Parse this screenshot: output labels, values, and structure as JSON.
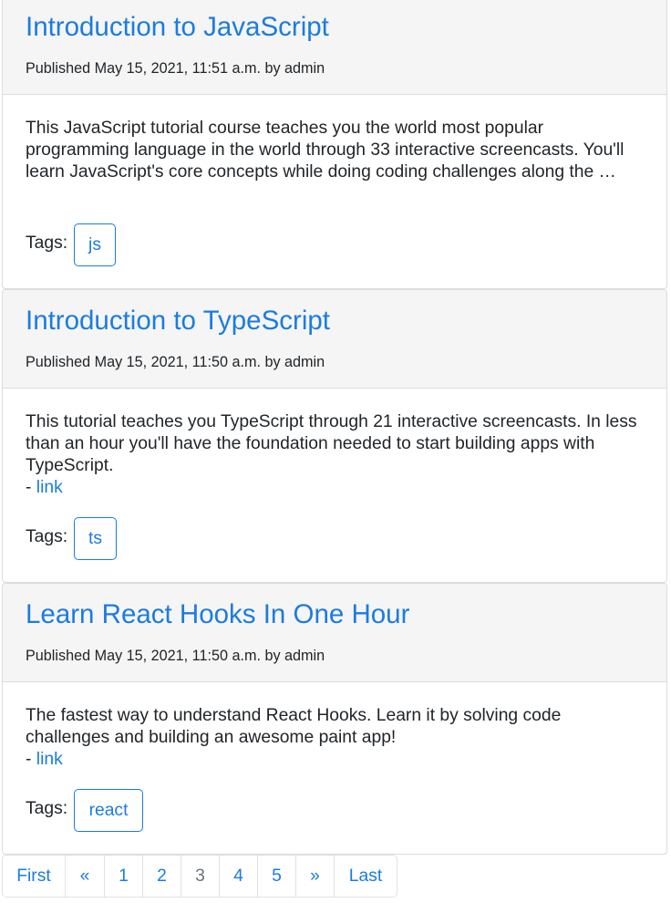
{
  "posts": [
    {
      "title": "Introduction to JavaScript",
      "meta": "Published May 15, 2021, 11:51 a.m. by admin",
      "body": "This JavaScript tutorial course teaches you the world most popular programming language in the world through 33 interactive screencasts. You'll learn JavaScript's core concepts while doing coding challenges along the …",
      "tags_label": "Tags:",
      "tags": [
        "js"
      ]
    },
    {
      "title": "Introduction to TypeScript",
      "meta": "Published May 15, 2021, 11:50 a.m. by admin",
      "body": "This tutorial teaches you TypeScript through 21 interactive screencasts. In less than an hour you'll have the foundation needed to start building apps with TypeScript.",
      "link_prefix": "- ",
      "link_text": "link",
      "tags_label": "Tags:",
      "tags": [
        "ts"
      ]
    },
    {
      "title": "Learn React Hooks In One Hour",
      "meta": "Published May 15, 2021, 11:50 a.m. by admin",
      "body": "The fastest way to understand React Hooks. Learn it by solving code challenges and building an awesome paint app!",
      "link_prefix": "- ",
      "link_text": "link",
      "tags_label": "Tags:",
      "tags": [
        "react"
      ]
    }
  ],
  "pagination": {
    "first": "First",
    "prev": "«",
    "pages": [
      "1",
      "2",
      "3",
      "4",
      "5"
    ],
    "current": "3",
    "next": "»",
    "last": "Last"
  },
  "colors": {
    "accent": "#1b7ce0",
    "header_bg": "#f5f5f5",
    "muted": "#6c757d"
  }
}
